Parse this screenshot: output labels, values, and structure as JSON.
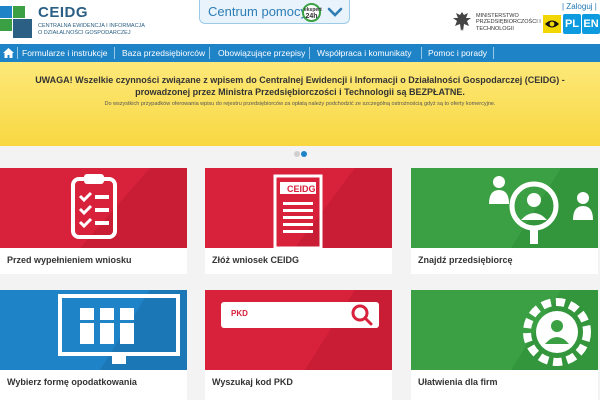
{
  "header": {
    "logo_title": "CEIDG",
    "logo_subtitle": "Centralna Ewidencja i Informacja o Działalności Gospodarczej",
    "help_label": "Centrum pomocy",
    "help_badge_top": "ekspert",
    "help_badge_main": "24h",
    "ministry": "Ministerstwo Przedsiębiorczości i Technologii",
    "login": "| Zaloguj |",
    "lang_pl": "PL",
    "lang_en": "EN"
  },
  "nav": {
    "items": [
      "Formularze i instrukcje",
      "Baza przedsiębiorców",
      "Obowiązujące przepisy",
      "Współpraca i komunikaty",
      "Pomoc i porady"
    ]
  },
  "banner": {
    "title": "UWAGA! Wszelkie czynności związane z wpisem do Centralnej Ewidencji i Informacji o Działalności Gospodarczej (CEIDG) - prowadzonej przez Ministra Przedsiębiorczości i Technologii są BEZPŁATNE.",
    "note": "Do wszystkich przypadków oferowania wpisu do rejestru przedsiębiorców za opłatą należy podchodzić ze szczególną ostrożnością gdyż są to oferty komercyjne."
  },
  "tiles": {
    "t1": "Przed wypełnieniem wniosku",
    "t2": "Złóż wniosek CEIDG",
    "t2_doc": "CEIDG",
    "t3": "Znajdź przedsiębiorcę",
    "t4": "Wybierz formę opodatkowania",
    "t5": "Wyszukaj kod PKD",
    "t5_field": "PKD",
    "t6": "Ułatwienia dla firm"
  },
  "colors": {
    "brand_blue": "#1f83c8",
    "tile_red": "#d8213b",
    "tile_green": "#3aa043",
    "banner_yellow": "#f8d741"
  }
}
